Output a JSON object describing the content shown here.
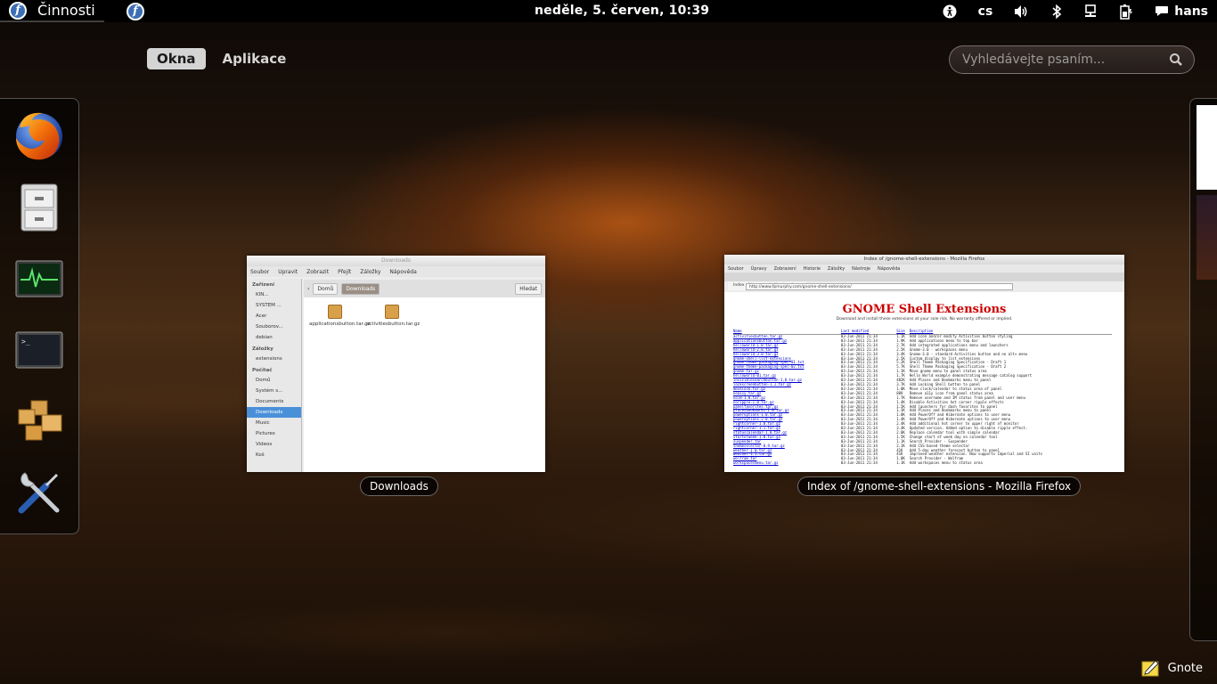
{
  "top_panel": {
    "activities_label": "Činnosti",
    "clock": "neděle,  5. červen, 10:39",
    "keyboard_layout": "cs",
    "user_name": "hans"
  },
  "overview": {
    "tabs": [
      {
        "label": "Okna",
        "active": true
      },
      {
        "label": "Aplikace",
        "active": false
      }
    ],
    "search_placeholder": "Vyhledávejte psaním..."
  },
  "dash": {
    "items": [
      {
        "icon": "firefox-icon",
        "name": "Firefox"
      },
      {
        "icon": "file-cabinet-icon",
        "name": "Files"
      },
      {
        "icon": "system-monitor-icon",
        "name": "System Monitor"
      },
      {
        "icon": "terminal-icon",
        "name": "Terminal"
      },
      {
        "icon": "packages-icon",
        "name": "Add/Remove Software"
      },
      {
        "icon": "tools-icon",
        "name": "System Tools"
      }
    ]
  },
  "windows": {
    "nautilus": {
      "caption": "Downloads",
      "title": "Downloads",
      "menu": [
        "Soubor",
        "Upravit",
        "Zobrazit",
        "Přejít",
        "Záložky",
        "Nápověda"
      ],
      "sidebar": {
        "devices_header": "Zařízení",
        "devices": [
          "KIN...",
          "SYSTEM ...",
          "Acer",
          "Souborov...",
          "debian"
        ],
        "bookmarks_header": "Záložky",
        "bookmarks": [
          "extensions"
        ],
        "computer_header": "Počítač",
        "computer": [
          "Domů",
          "Systém s...",
          "Documents",
          "Downloads",
          "Music",
          "Pictures",
          "Videos",
          "Koš"
        ]
      },
      "path": [
        "Domů",
        "Downloads"
      ],
      "search_button": "Hledat",
      "files": [
        "applicationsbutton.tar.gz",
        "activitiesbutton.tar.gz"
      ]
    },
    "firefox": {
      "caption": "Index of /gnome-shell-extensions - Mozilla Firefox",
      "title": "Index of /gnome-shell-extensions - Mozilla Firefox",
      "menu": [
        "Soubor",
        "Úpravy",
        "Zobrazení",
        "Historie",
        "Záložky",
        "Nástroje",
        "Nápověda"
      ],
      "tab_label": "Index of /gnome-shell-extensions",
      "url": "http://www.fpmurphy.com/gnome-shell-extensions/",
      "page_heading": "GNOME Shell Extensions",
      "page_sub": "Download and install these extensions at your sole risk. No warranty offered or implied.",
      "table_headers": [
        "Name",
        "Last modified",
        "Size",
        "Description"
      ],
      "rows": [
        [
          "activitiesbutton.tar.gz",
          "03-Jun-2011 21:34",
          "1.1K",
          "Add icon and/or modify Activities button styling"
        ],
        [
          "applicationsbutton.tar.gz",
          "03-Jun-2011 21:34",
          "1.9K",
          "Add applications menu to top bar"
        ],
        [
          "helloworld-1.0.tar.gz",
          "03-Jun-2011 21:34",
          "2.7K",
          "Add integrated applications menu and launchers"
        ],
        [
          "helloworld-2.0.tar.gz",
          "03-Jun-2011 21:34",
          "2.5K",
          "Gnome-3.0 - workspaces menu"
        ],
        [
          "helloworld-3.0.tar.gz",
          "03-Jun-2011 21:34",
          "3.4K",
          "Gnome-3.0 - standard Activities button and no alt+ menu"
        ],
        [
          "gnome-shell-list-extensions",
          "03-Jun-2011 21:34",
          "2.5K",
          "Custom display to list extensions"
        ],
        [
          "gnome-theme-packaging-spec-01.txt",
          "03-Jun-2011 21:34",
          "5.2K",
          "Shell Theme Packaging Specification - Draft 1"
        ],
        [
          "gnome-theme-packaging-spec-02.txt",
          "03-Jun-2011 21:34",
          "5.7K",
          "Shell Theme Packaging Specification - Draft 2"
        ],
        [
          "gnome-tar.gz",
          "03-Jun-2011 21:34",
          "1.1K",
          "Move gnome menu to panel status area"
        ],
        [
          "helloworld-01.tar.gz",
          "03-Jun-2011 21:34",
          "1.7K",
          "Hello World example demonstrating message catalog support"
        ],
        [
          "invisiblesearchbutton-1.0.tar.gz",
          "03-Jun-2011 21:34",
          "482K",
          "Add Places and Bookmarks menu to panel"
        ],
        [
          "lockscreenbutton-1.1.tar.gz",
          "03-Jun-2011 21:34",
          "3.7K",
          "Add Locking Shell button to panel"
        ],
        [
          "movelock.tar.gz",
          "03-Jun-2011 21:34",
          "1.0K",
          "Move clock/calendar to status area of panel"
        ],
        [
          "noa11y.tar.gz",
          "03-Jun-2011 21:34",
          "889",
          "Remove a11y icon from panel status area"
        ],
        [
          "noim-1.0.tar.gz",
          "03-Jun-2011 21:34",
          "1.7K",
          "Remove username and IM status from panel and user menu"
        ],
        [
          "noripple-1.0.tar.gz",
          "03-Jun-2011 21:34",
          "1.4K",
          "Disable Activities hot corner ripple effects"
        ],
        [
          "panelfavorites.tar.gz",
          "03-Jun-2011 21:34",
          "1.5K",
          "Add launchers for dash favorites to panel"
        ],
        [
          "placesbookmarks-1.0.tar.gz",
          "03-Jun-2011 21:34",
          "1.3K",
          "Add Places and Bookmarks menu to panel"
        ],
        [
          "poweroptions-1.0.tar.gz",
          "03-Jun-2011 21:34",
          "1.0K",
          "Add PowerOff and Hibernate options to user menu"
        ],
        [
          "poweroptions-2.0.tar.gz",
          "03-Jun-2011 21:34",
          "1.4K",
          "Add PowerOff and Hibernate options to user menu"
        ],
        [
          "rightcorner-1.0.tar.gz",
          "03-Jun-2011 21:34",
          "2.4K",
          "Add additional hot corner to upper right of monitor"
        ],
        [
          "rightcorner-1.1.tar.gz",
          "03-Jun-2011 21:34",
          "3.4K",
          "Updated version. Added option to disable ripple effect."
        ],
        [
          "statuscalendar-1.0.tar.gz",
          "03-Jun-2011 21:34",
          "2.0K",
          "Replace calendar tool with simple calendar"
        ],
        [
          "startofweek-1.0.tar.gz",
          "03-Jun-2011 21:34",
          "1.5K",
          "Change start of week day on calendar tool"
        ],
        [
          "suspender.tar",
          "03-Jun-2011 21:34",
          "1.1K",
          "Search Provider - Suspender"
        ],
        [
          "themeselector-0.9.tar.gz",
          "03-Jun-2011 21:34",
          "2.1K",
          "Add CSS-based theme selector"
        ],
        [
          "weather-1.0.tar.gz",
          "03-Jun-2011 21:34",
          "41K",
          "Add 5-day weather forecast button to panel"
        ],
        [
          "weather-1.1.tar.gz",
          "03-Jun-2011 21:34",
          "41K",
          "Improved weather extension. Now supports Imperial and SI units"
        ],
        [
          "wolfram.tar",
          "03-Jun-2011 21:34",
          "1.0K",
          "Search Provider - Wolfram"
        ],
        [
          "workspacesmenu.tar.gz",
          "03-Jun-2011 21:34",
          "1.1K",
          "Add workspaces menu to status area"
        ]
      ]
    }
  },
  "notification": {
    "app_name": "Gnote"
  }
}
